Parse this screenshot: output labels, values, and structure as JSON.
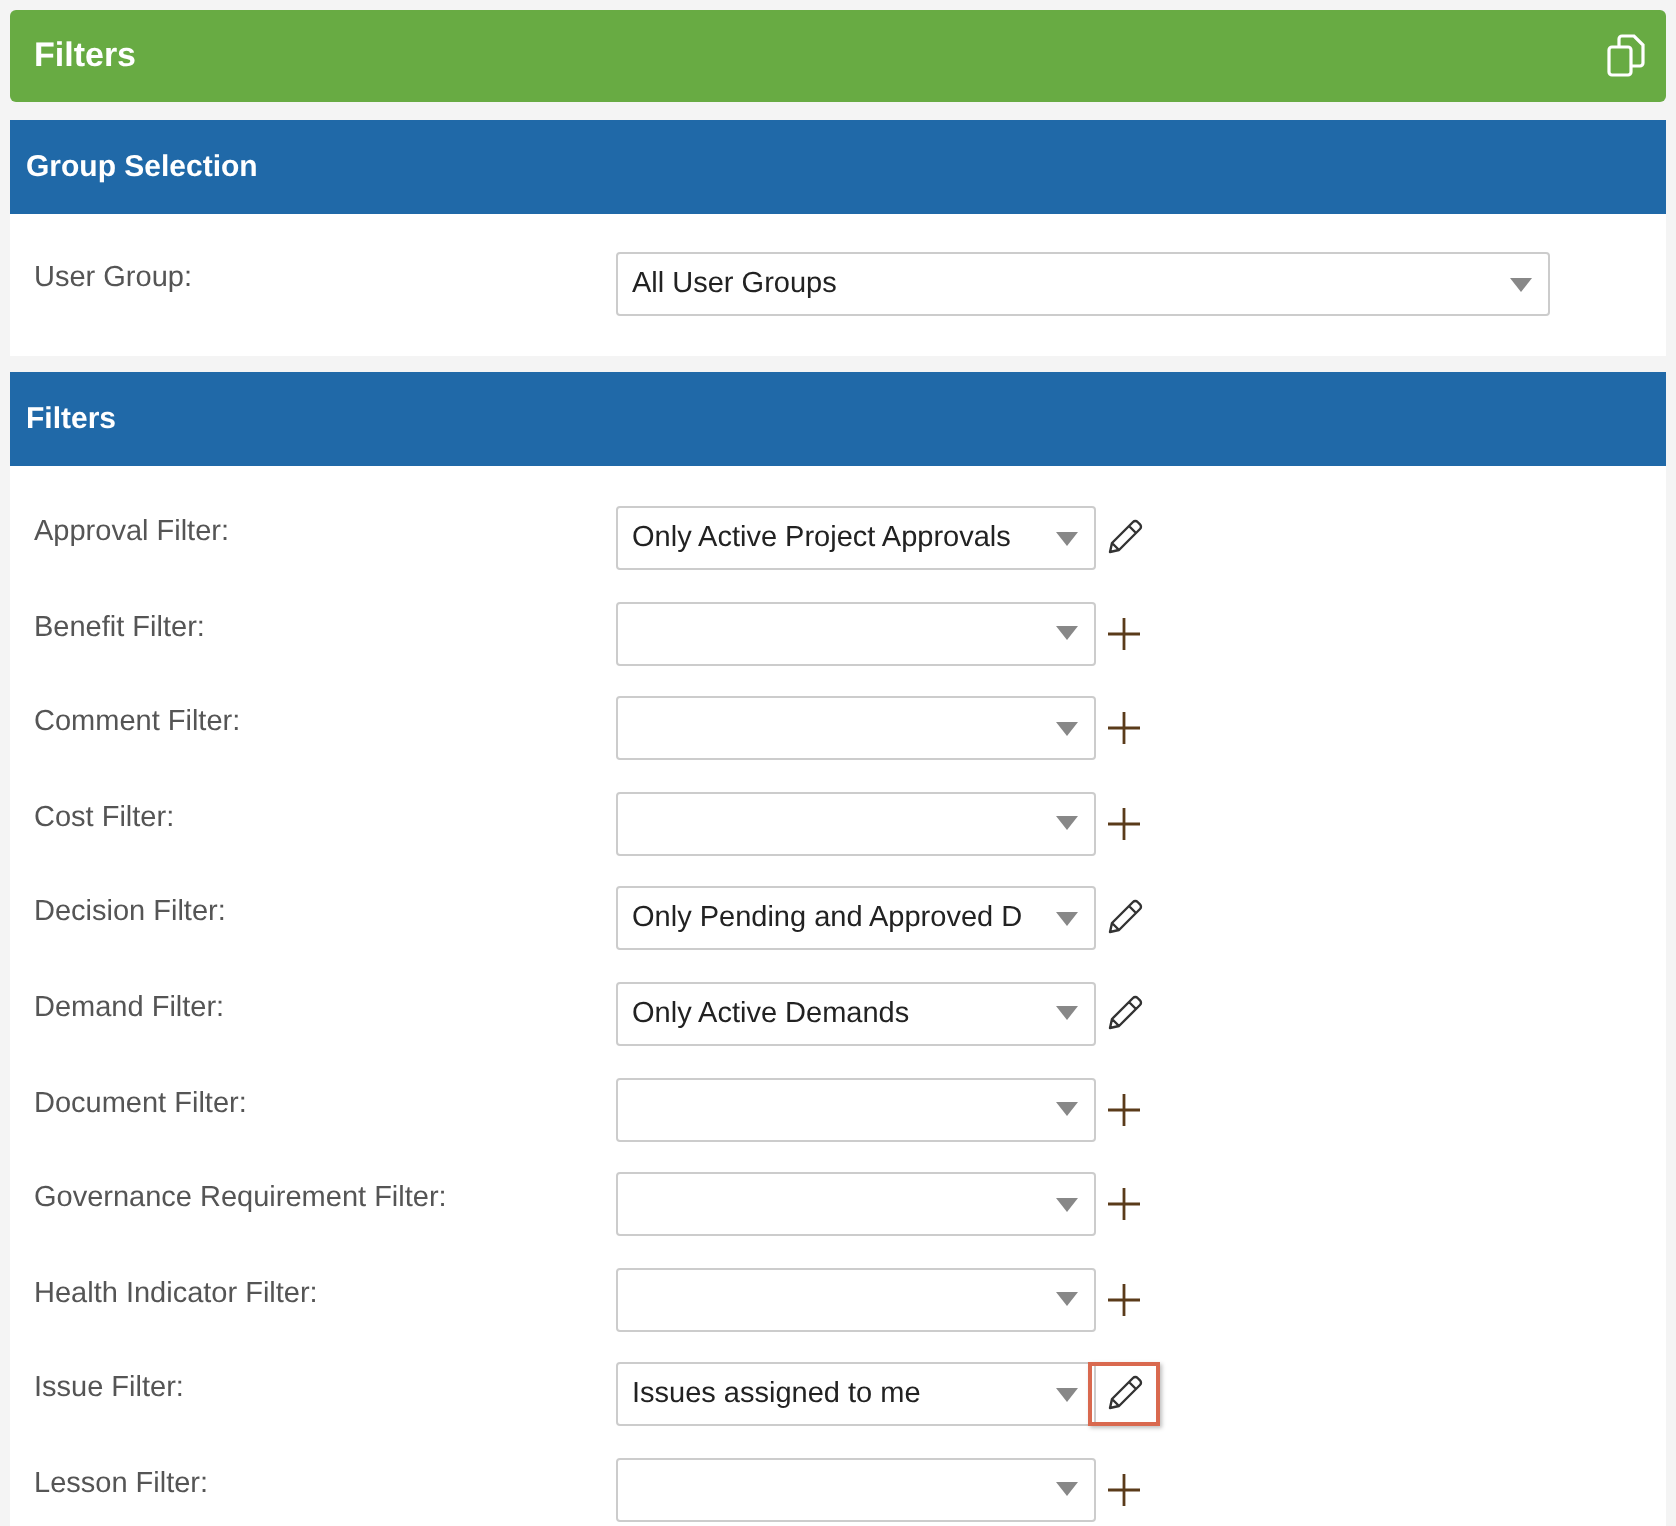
{
  "header": {
    "title": "Filters"
  },
  "group_selection": {
    "title": "Group Selection",
    "label": "User Group:",
    "value": "All User Groups"
  },
  "filters": {
    "title": "Filters",
    "rows": [
      {
        "label": "Approval Filter:",
        "value": "Only Active Project Approvals",
        "kind": "edit",
        "highlighted": false
      },
      {
        "label": "Benefit Filter:",
        "kind": "add",
        "highlighted": false
      },
      {
        "label": "Comment Filter:",
        "kind": "add",
        "highlighted": false
      },
      {
        "label": "Cost Filter:",
        "kind": "add",
        "highlighted": false
      },
      {
        "label": "Decision Filter:",
        "value": "Only Pending and Approved D",
        "kind": "edit",
        "highlighted": false
      },
      {
        "label": "Demand Filter:",
        "value": "Only Active Demands",
        "kind": "edit",
        "highlighted": false
      },
      {
        "label": "Document Filter:",
        "kind": "add",
        "highlighted": false
      },
      {
        "label": "Governance Requirement Filter:",
        "kind": "add",
        "highlighted": false
      },
      {
        "label": "Health Indicator Filter:",
        "kind": "add",
        "highlighted": false
      },
      {
        "label": "Issue Filter:",
        "value": "Issues assigned to me",
        "kind": "edit",
        "highlighted": true
      },
      {
        "label": "Lesson Filter:",
        "kind": "add",
        "highlighted": false
      }
    ]
  }
}
